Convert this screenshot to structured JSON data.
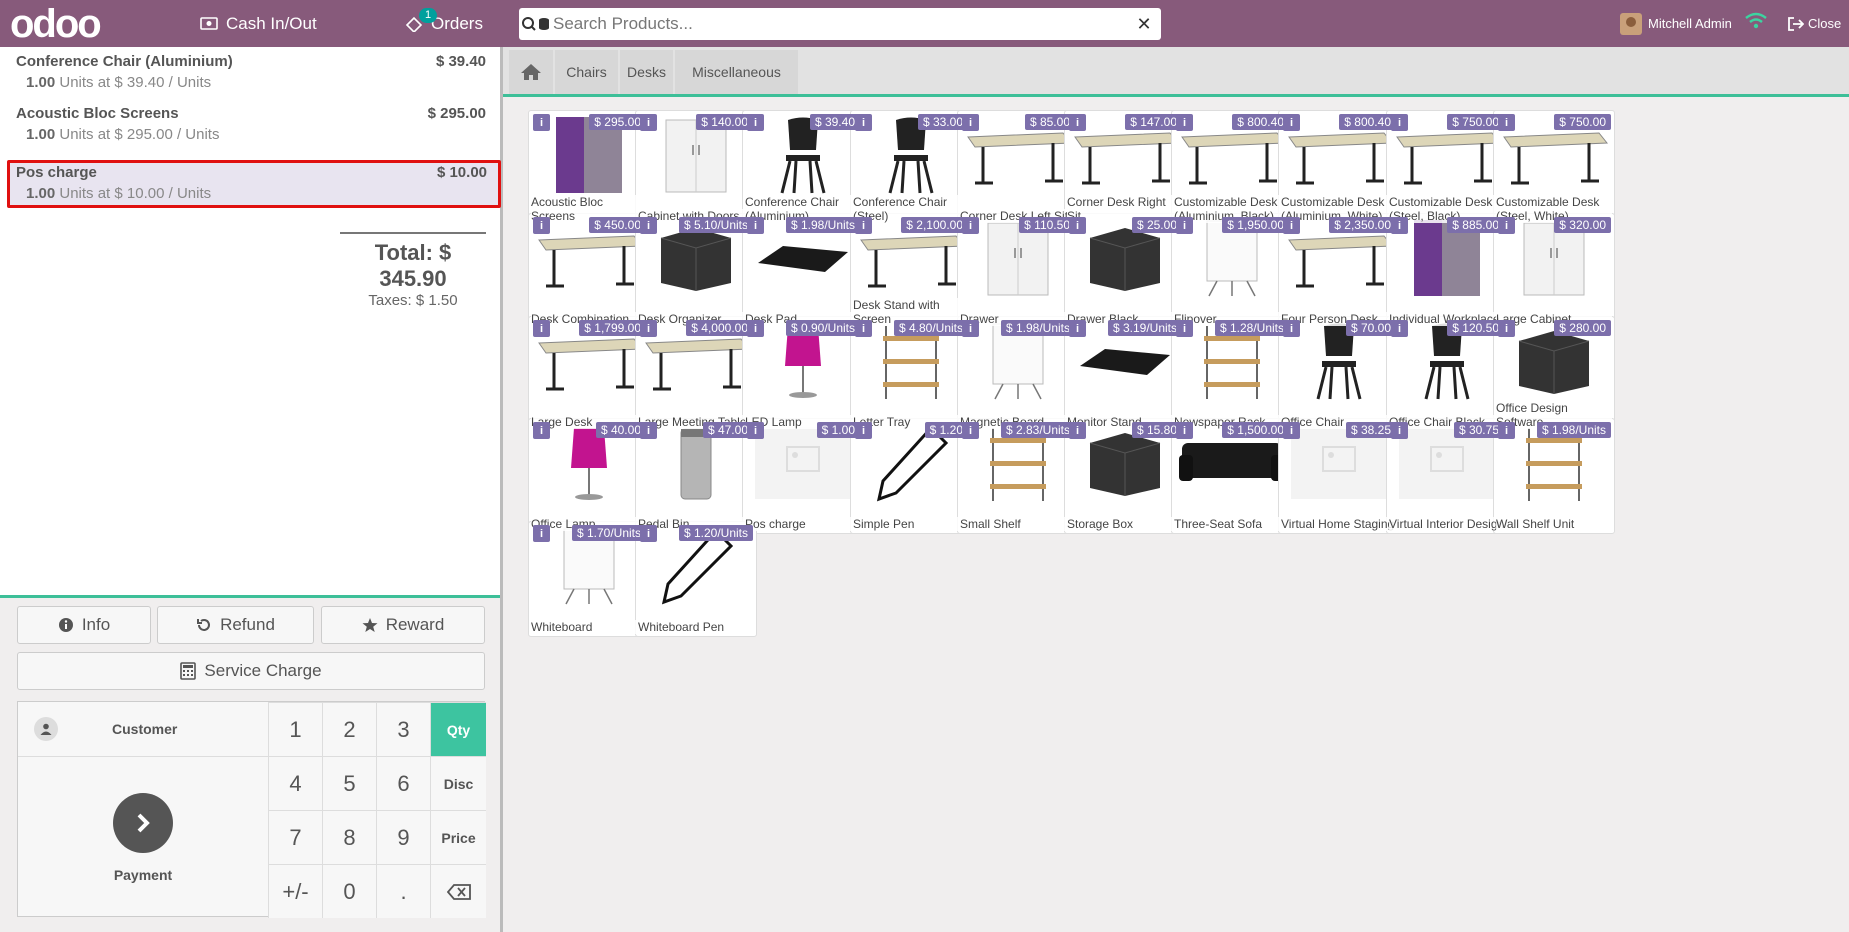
{
  "header": {
    "logo": "odoo",
    "cash_label": "Cash In/Out",
    "orders_label": "Orders",
    "orders_badge": "1",
    "search_placeholder": "Search Products...",
    "user_name": "Mitchell Admin",
    "close_label": "Close"
  },
  "order": {
    "lines": [
      {
        "name": "Conference Chair (Aluminium)",
        "price": "$ 39.40",
        "qty": "1.00",
        "unit_info": "Units at $ 39.40 / Units",
        "selected": false
      },
      {
        "name": "Acoustic Bloc Screens",
        "price": "$ 295.00",
        "qty": "1.00",
        "unit_info": "Units at $ 295.00 / Units",
        "selected": false
      },
      {
        "name": "Pos charge",
        "price": "$ 10.00",
        "qty": "1.00",
        "unit_info": "Units at $ 10.00 / Units",
        "selected": true
      }
    ],
    "total": "Total: $ 345.90",
    "taxes": "Taxes: $ 1.50"
  },
  "actions": {
    "info": "Info",
    "refund": "Refund",
    "reward": "Reward",
    "service_charge": "Service Charge"
  },
  "numpad": {
    "customer": "Customer",
    "payment": "Payment",
    "keys": [
      "1",
      "2",
      "3",
      "4",
      "5",
      "6",
      "7",
      "8",
      "9",
      "+/-",
      "0",
      "."
    ],
    "modes": [
      "Qty",
      "Disc",
      "Price"
    ],
    "active_mode": "Qty"
  },
  "categories": [
    "Chairs",
    "Desks",
    "Miscellaneous"
  ],
  "colors": {
    "brand": "#875a7b",
    "accent": "#3dbf98",
    "price_badge": "#7c6fab",
    "selected_outline": "#e01010"
  },
  "products": [
    {
      "name": "Acoustic Bloc Screens",
      "price": "$ 295.00",
      "icon": "screen"
    },
    {
      "name": "Cabinet with Doors",
      "price": "$ 140.00",
      "icon": "cabinet"
    },
    {
      "name": "Conference Chair (Aluminium)",
      "price": "$ 39.40",
      "icon": "chair"
    },
    {
      "name": "Conference Chair (Steel)",
      "price": "$ 33.00",
      "icon": "chair"
    },
    {
      "name": "Corner Desk Left Sit",
      "price": "$ 85.00",
      "icon": "desk"
    },
    {
      "name": "Corner Desk Right Sit",
      "price": "$ 147.00",
      "icon": "desk"
    },
    {
      "name": "Customizable Desk (Aluminium, Black)",
      "price": "$ 800.40",
      "icon": "desk"
    },
    {
      "name": "Customizable Desk (Aluminium, White)",
      "price": "$ 800.40",
      "icon": "desk"
    },
    {
      "name": "Customizable Desk (Steel, Black)",
      "price": "$ 750.00",
      "icon": "desk"
    },
    {
      "name": "Customizable Desk (Steel, White)",
      "price": "$ 750.00",
      "icon": "desk"
    },
    {
      "name": "Desk Combination",
      "price": "$ 450.00",
      "icon": "desk"
    },
    {
      "name": "Desk Organizer",
      "price": "$ 5.10/Units",
      "icon": "box"
    },
    {
      "name": "Desk Pad",
      "price": "$ 1.98/Units",
      "icon": "pad"
    },
    {
      "name": "Desk Stand with Screen",
      "price": "$ 2,100.00",
      "icon": "desk"
    },
    {
      "name": "Drawer",
      "price": "$ 110.50",
      "icon": "cabinet"
    },
    {
      "name": "Drawer Black",
      "price": "$ 25.00",
      "icon": "box"
    },
    {
      "name": "Flipover",
      "price": "$ 1,950.00",
      "icon": "board"
    },
    {
      "name": "Four Person Desk",
      "price": "$ 2,350.00",
      "icon": "desk"
    },
    {
      "name": "Individual Workplace",
      "price": "$ 885.00",
      "icon": "screen"
    },
    {
      "name": "Large Cabinet",
      "price": "$ 320.00",
      "icon": "cabinet"
    },
    {
      "name": "Large Desk",
      "price": "$ 1,799.00",
      "icon": "desk"
    },
    {
      "name": "Large Meeting Table",
      "price": "$ 4,000.00",
      "icon": "desk"
    },
    {
      "name": "LED Lamp",
      "price": "$ 0.90/Units",
      "icon": "lamp"
    },
    {
      "name": "Letter Tray",
      "price": "$ 4.80/Units",
      "icon": "shelf"
    },
    {
      "name": "Magnetic Board",
      "price": "$ 1.98/Units",
      "icon": "board"
    },
    {
      "name": "Monitor Stand",
      "price": "$ 3.19/Units",
      "icon": "pad"
    },
    {
      "name": "Newspaper Rack",
      "price": "$ 1.28/Units",
      "icon": "shelf"
    },
    {
      "name": "Office Chair",
      "price": "$ 70.00",
      "icon": "chair"
    },
    {
      "name": "Office Chair Black",
      "price": "$ 120.50",
      "icon": "chair"
    },
    {
      "name": "Office Design Software",
      "price": "$ 280.00",
      "icon": "box"
    },
    {
      "name": "Office Lamp",
      "price": "$ 40.00",
      "icon": "lamp"
    },
    {
      "name": "Pedal Bin",
      "price": "$ 47.00",
      "icon": "bin"
    },
    {
      "name": "Pos charge",
      "price": "$ 1.00",
      "icon": "placeholder"
    },
    {
      "name": "Simple Pen",
      "price": "$ 1.20",
      "icon": "pen"
    },
    {
      "name": "Small Shelf",
      "price": "$ 2.83/Units",
      "icon": "shelf"
    },
    {
      "name": "Storage Box",
      "price": "$ 15.80",
      "icon": "box"
    },
    {
      "name": "Three-Seat Sofa",
      "price": "$ 1,500.00",
      "icon": "sofa"
    },
    {
      "name": "Virtual Home Staging",
      "price": "$ 38.25",
      "icon": "placeholder"
    },
    {
      "name": "Virtual Interior Design",
      "price": "$ 30.75",
      "icon": "placeholder"
    },
    {
      "name": "Wall Shelf Unit",
      "price": "$ 1.98/Units",
      "icon": "shelf"
    },
    {
      "name": "Whiteboard",
      "price": "$ 1.70/Units",
      "icon": "board"
    },
    {
      "name": "Whiteboard Pen",
      "price": "$ 1.20/Units",
      "icon": "pen"
    }
  ]
}
